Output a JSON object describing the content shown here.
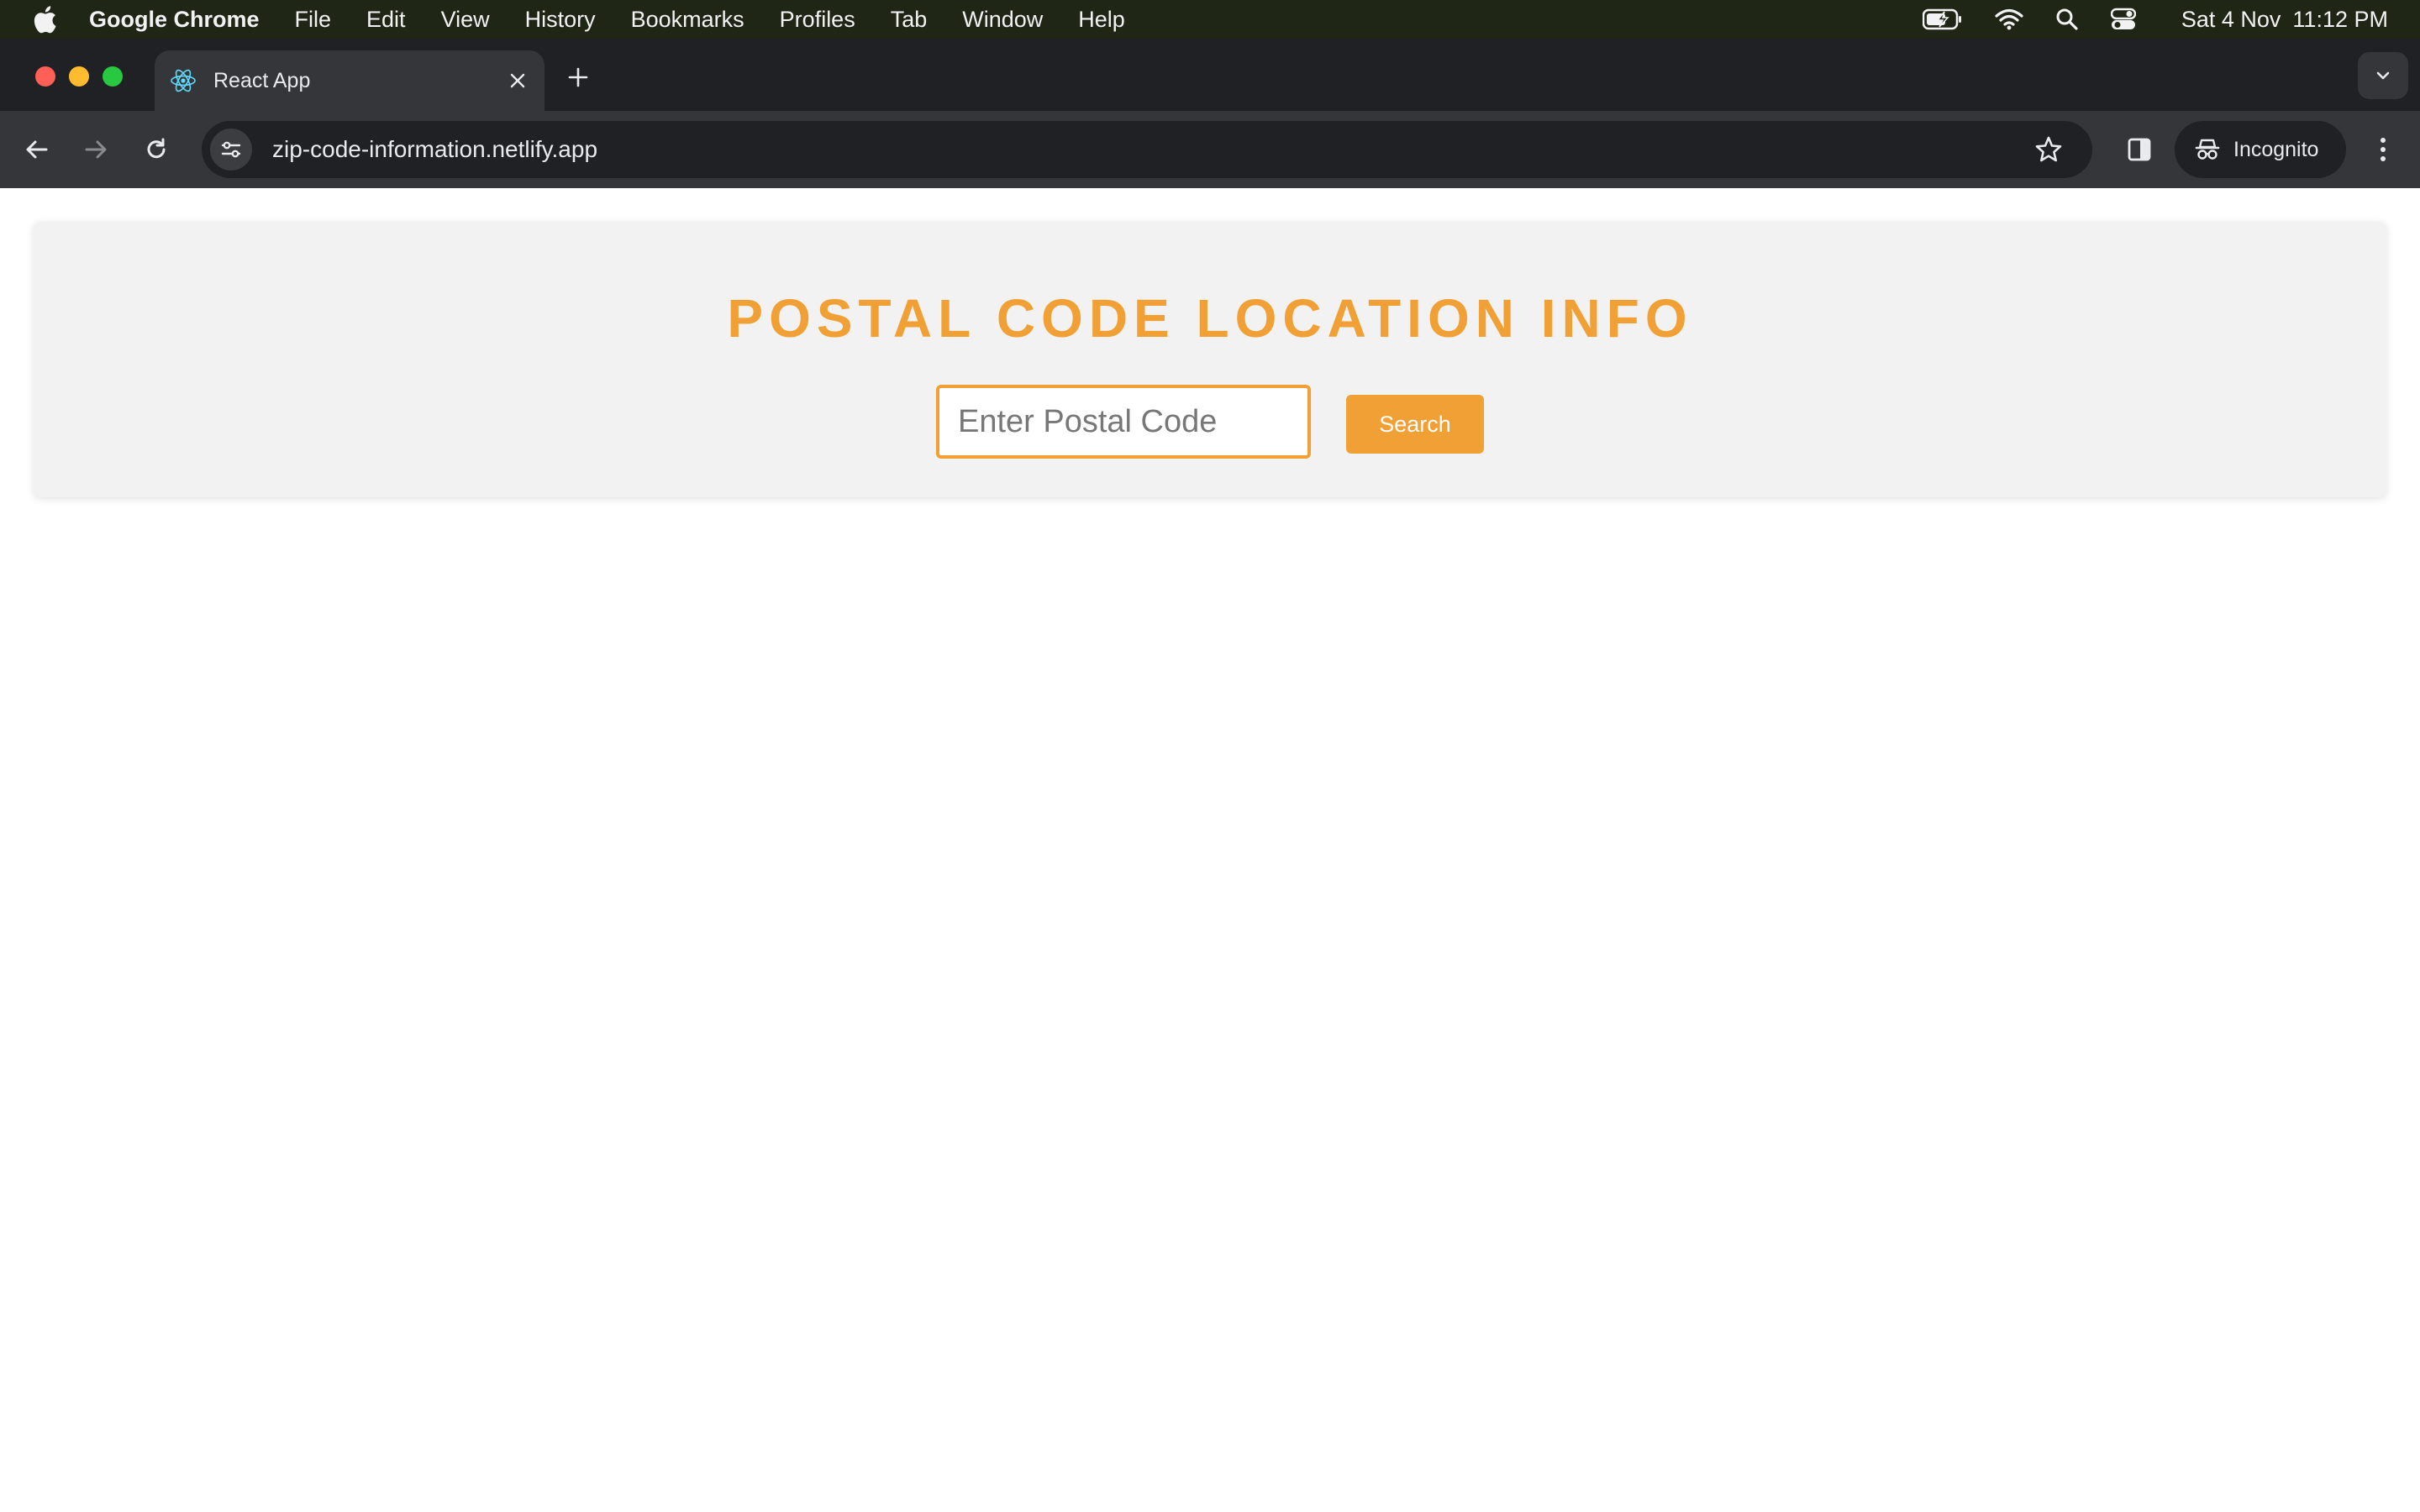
{
  "menubar": {
    "app_name": "Google Chrome",
    "items": [
      "File",
      "Edit",
      "View",
      "History",
      "Bookmarks",
      "Profiles",
      "Tab",
      "Window",
      "Help"
    ],
    "date": "Sat 4 Nov",
    "time": "11:12 PM"
  },
  "browser": {
    "tab_title": "React App",
    "url": "zip-code-information.netlify.app",
    "profile_label": "Incognito"
  },
  "page": {
    "heading": "POSTAL CODE LOCATION INFO",
    "input_placeholder": "Enter Postal Code",
    "input_value": "",
    "search_label": "Search"
  },
  "colors": {
    "accent": "#f0a035",
    "card_background": "#f2f2f2",
    "chrome_dark": "#202124",
    "chrome_toolbar": "#35363a"
  },
  "icons": {
    "menubar_left": "apple-logo-icon",
    "menubar_right": [
      "battery-icon",
      "wifi-icon",
      "spotlight-search-icon",
      "control-center-icon"
    ],
    "tab_favicon": "react-icon",
    "toolbar": [
      "back-arrow-icon",
      "forward-arrow-icon",
      "reload-icon",
      "site-info-icon",
      "bookmark-star-icon",
      "side-panel-icon",
      "incognito-icon",
      "more-vert-icon"
    ]
  }
}
